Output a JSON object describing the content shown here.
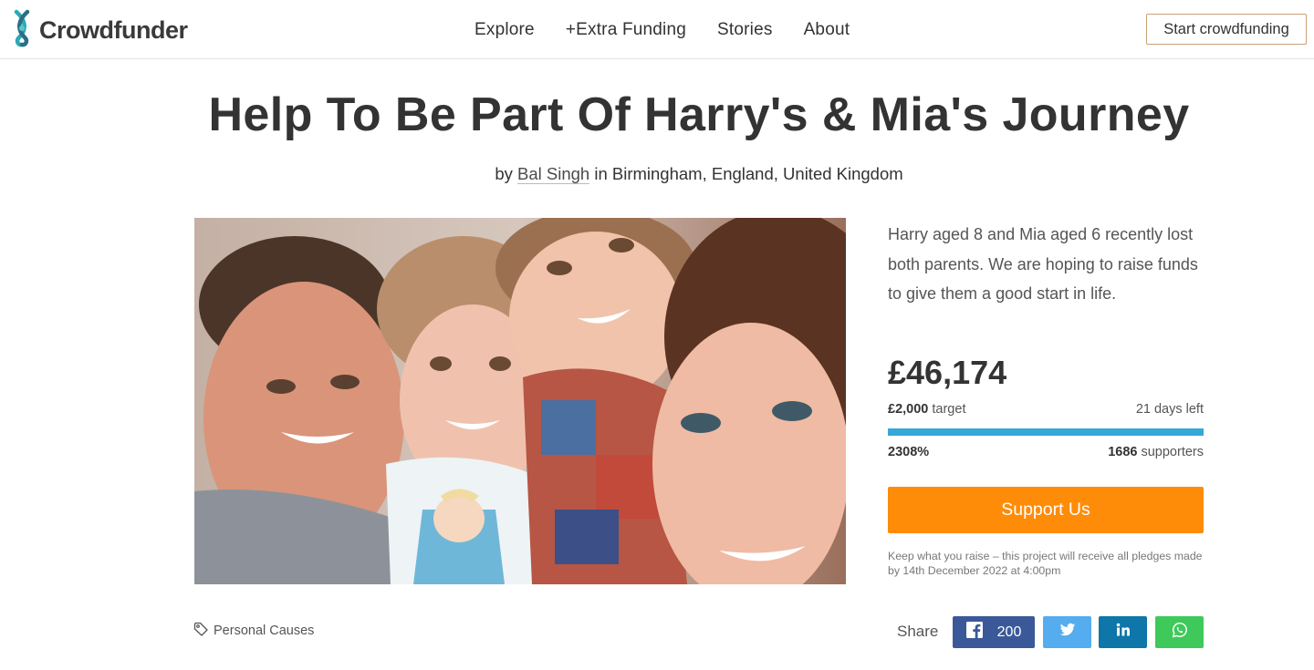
{
  "header": {
    "logo_text": "Crowdfunder",
    "nav": [
      "Explore",
      "+Extra Funding",
      "Stories",
      "About"
    ],
    "start_button": "Start crowdfunding"
  },
  "project": {
    "title": "Help To Be Part Of Harry's & Mia's Journey",
    "by_prefix": "by",
    "author": "Bal Singh",
    "location_prefix": "in",
    "location": "Birmingham, England, United Kingdom",
    "description": "Harry aged 8 and Mia aged 6 recently lost both parents. We are hoping to raise funds to give them a good start in life.",
    "amount_raised": "£46,174",
    "target_amount": "£2,000",
    "target_label": "target",
    "days_left": "21 days left",
    "percent": "2308%",
    "progress_fraction": 1.0,
    "supporters_count": "1686",
    "supporters_label": "supporters",
    "support_button": "Support Us",
    "note": "Keep what you raise – this project will receive all pledges made by 14th December 2022 at 4:00pm",
    "category": "Personal Causes"
  },
  "share": {
    "label": "Share",
    "facebook_count": "200"
  },
  "colors": {
    "progress": "#35a8d8",
    "support_button": "#ff8c08",
    "facebook": "#3b5998",
    "twitter": "#55acee",
    "linkedin": "#0e76a8",
    "whatsapp": "#3ec95a"
  },
  "icons": [
    "crowdfunder-logo-icon",
    "tag-icon",
    "facebook-icon",
    "twitter-icon",
    "linkedin-icon",
    "whatsapp-icon"
  ]
}
